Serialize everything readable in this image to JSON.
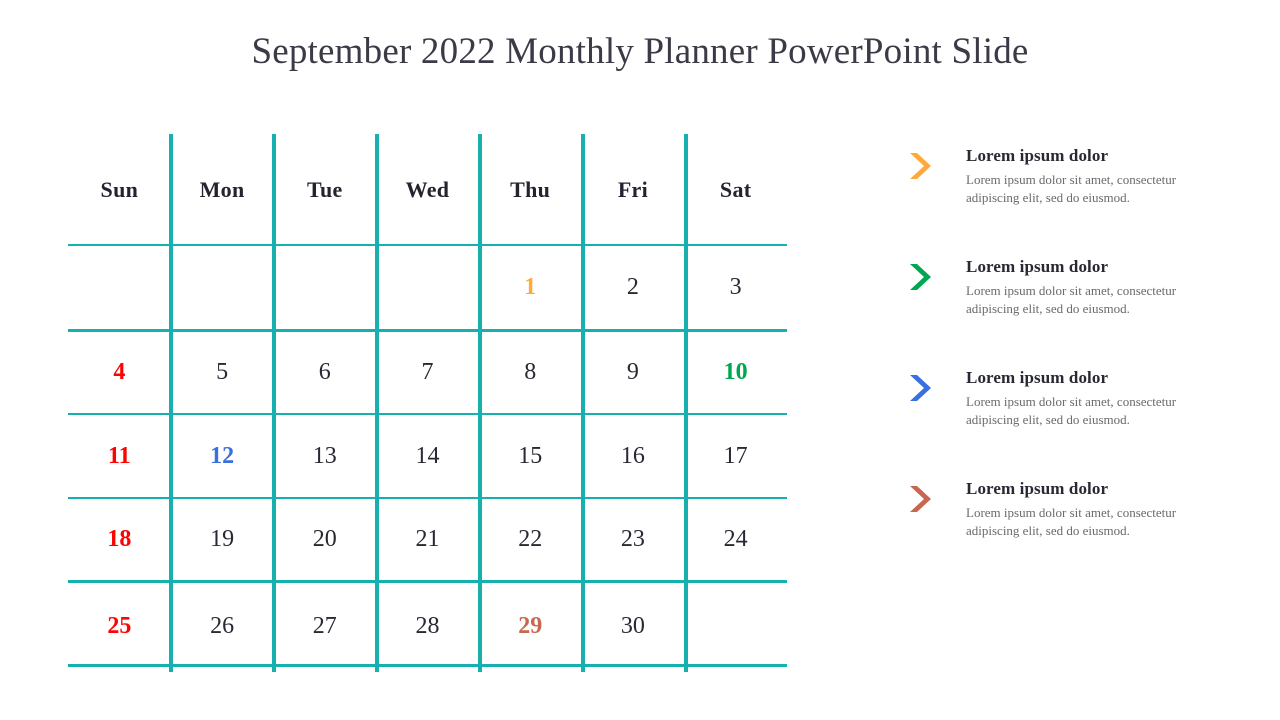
{
  "slide": {
    "title": "September 2022 Monthly Planner PowerPoint Slide",
    "background": "#ffffff",
    "title_color": "#3b3a46"
  },
  "theme": {
    "grid_line": "#17b0ae",
    "default_date": "#2b2733",
    "weekend_red": "#fb0404",
    "accent_orange": "#ffa93a",
    "accent_green": "#00a651",
    "accent_blue": "#3a6fe0",
    "accent_terracotta": "#c8674f",
    "body_text": "#6a6a6f"
  },
  "calendar": {
    "month": "September",
    "year": "2022",
    "weekday_headers": [
      {
        "label": "Sun"
      },
      {
        "label": "Mon"
      },
      {
        "label": "Tue"
      },
      {
        "label": "Wed"
      },
      {
        "label": "Thu"
      },
      {
        "label": "Fri"
      },
      {
        "label": "Sat"
      }
    ],
    "weeks": [
      [
        {
          "day": "",
          "color": "#2b2733",
          "accent": false
        },
        {
          "day": "",
          "color": "#2b2733",
          "accent": false
        },
        {
          "day": "",
          "color": "#2b2733",
          "accent": false
        },
        {
          "day": "",
          "color": "#2b2733",
          "accent": false
        },
        {
          "day": "1",
          "color": "#ffa93a",
          "accent": true
        },
        {
          "day": "2",
          "color": "#2b2733",
          "accent": false
        },
        {
          "day": "3",
          "color": "#2b2733",
          "accent": false
        }
      ],
      [
        {
          "day": "4",
          "color": "#fb0404",
          "accent": true
        },
        {
          "day": "5",
          "color": "#2b2733",
          "accent": false
        },
        {
          "day": "6",
          "color": "#2b2733",
          "accent": false
        },
        {
          "day": "7",
          "color": "#2b2733",
          "accent": false
        },
        {
          "day": "8",
          "color": "#2b2733",
          "accent": false
        },
        {
          "day": "9",
          "color": "#2b2733",
          "accent": false
        },
        {
          "day": "10",
          "color": "#00a651",
          "accent": true
        }
      ],
      [
        {
          "day": "11",
          "color": "#fb0404",
          "accent": true
        },
        {
          "day": "12",
          "color": "#3a6fe0",
          "accent": true
        },
        {
          "day": "13",
          "color": "#2b2733",
          "accent": false
        },
        {
          "day": "14",
          "color": "#2b2733",
          "accent": false
        },
        {
          "day": "15",
          "color": "#2b2733",
          "accent": false
        },
        {
          "day": "16",
          "color": "#2b2733",
          "accent": false
        },
        {
          "day": "17",
          "color": "#2b2733",
          "accent": false
        }
      ],
      [
        {
          "day": "18",
          "color": "#fb0404",
          "accent": true
        },
        {
          "day": "19",
          "color": "#2b2733",
          "accent": false
        },
        {
          "day": "20",
          "color": "#2b2733",
          "accent": false
        },
        {
          "day": "21",
          "color": "#2b2733",
          "accent": false
        },
        {
          "day": "22",
          "color": "#2b2733",
          "accent": false
        },
        {
          "day": "23",
          "color": "#2b2733",
          "accent": false
        },
        {
          "day": "24",
          "color": "#2b2733",
          "accent": false
        }
      ],
      [
        {
          "day": "25",
          "color": "#fb0404",
          "accent": true
        },
        {
          "day": "26",
          "color": "#2b2733",
          "accent": false
        },
        {
          "day": "27",
          "color": "#2b2733",
          "accent": false
        },
        {
          "day": "28",
          "color": "#2b2733",
          "accent": false
        },
        {
          "day": "29",
          "color": "#c8674f",
          "accent": true
        },
        {
          "day": "30",
          "color": "#2b2733",
          "accent": false
        },
        {
          "day": "",
          "color": "#2b2733",
          "accent": false
        }
      ]
    ]
  },
  "notes": [
    {
      "icon": "chevron-right-icon",
      "icon_color": "#ffa93a",
      "title": "Lorem ipsum dolor",
      "body": "Lorem ipsum dolor sit amet, consectetur adipiscing elit, sed do eiusmod."
    },
    {
      "icon": "chevron-right-icon",
      "icon_color": "#00a651",
      "title": "Lorem ipsum dolor",
      "body": "Lorem ipsum dolor sit amet, consectetur adipiscing elit, sed do eiusmod."
    },
    {
      "icon": "chevron-right-icon",
      "icon_color": "#3a6fe0",
      "title": "Lorem ipsum dolor",
      "body": "Lorem ipsum dolor sit amet, consectetur adipiscing elit, sed do eiusmod."
    },
    {
      "icon": "chevron-right-icon",
      "icon_color": "#c8674f",
      "title": "Lorem ipsum dolor",
      "body": "Lorem ipsum dolor sit amet, consectetur adipiscing elit, sed do eiusmod."
    }
  ]
}
